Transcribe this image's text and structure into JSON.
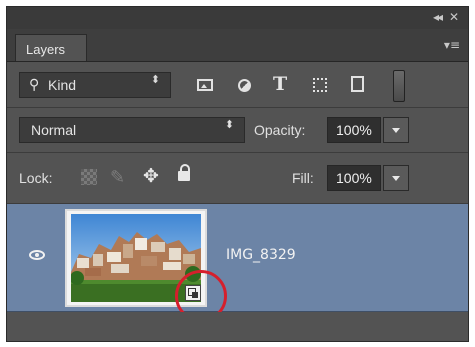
{
  "window": {
    "collapse_glyph": "◂◂",
    "close_glyph": "✕",
    "panel_menu_glyph": "▾≡"
  },
  "panel": {
    "tab_label": "Layers"
  },
  "filter_row": {
    "kind_label": "Kind",
    "search_glyph": "⚲",
    "spinner_glyph": "⬍",
    "type_filter_glyph": "T",
    "icons": [
      "image-filter-icon",
      "adjustment-filter-icon",
      "type-filter-icon",
      "shape-filter-icon",
      "smart-object-filter-icon",
      "filter-toggle-switch"
    ]
  },
  "blend_row": {
    "mode": "Normal",
    "spinner_glyph": "⬍",
    "opacity_label": "Opacity:",
    "opacity_value": "100%"
  },
  "lock_row": {
    "lock_label": "Lock:",
    "brush_glyph": "✎",
    "move_glyph": "✥",
    "fill_label": "Fill:",
    "fill_value": "100%",
    "icons": [
      "lock-transparent-pixels-icon",
      "lock-image-pixels-icon",
      "lock-position-icon",
      "lock-all-icon"
    ]
  },
  "layers": [
    {
      "name": "IMG_8329",
      "visible": true,
      "selected": true,
      "smart_object": true,
      "highlight_color": "#d61f2c"
    }
  ],
  "colors": {
    "panel_bg": "#535353",
    "selected_layer_bg": "#6c84a6",
    "annotation_ring": "#d61f2c"
  }
}
